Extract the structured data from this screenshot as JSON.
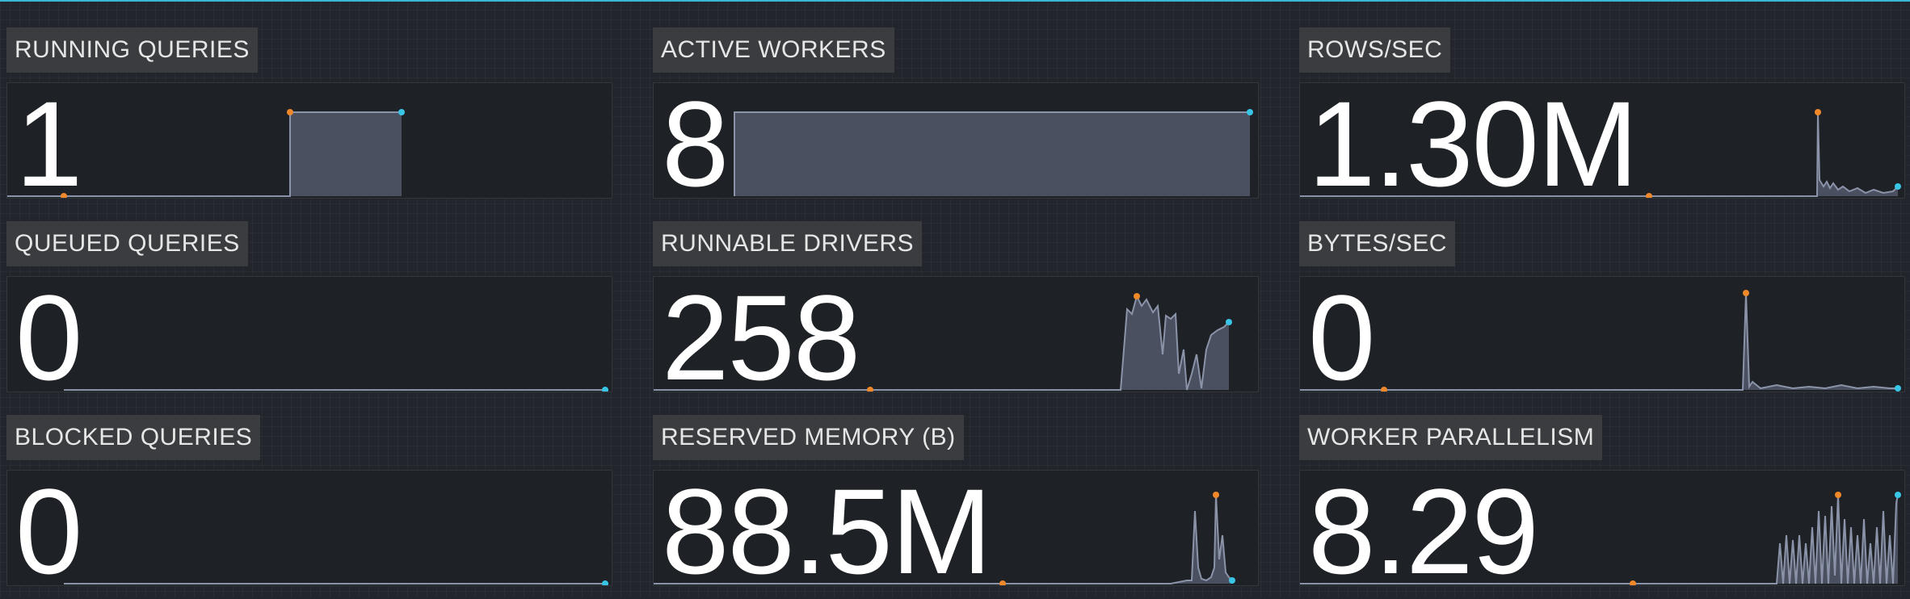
{
  "metrics": {
    "running_queries": {
      "label": "RUNNING QUERIES",
      "value": "1"
    },
    "active_workers": {
      "label": "ACTIVE WORKERS",
      "value": "8"
    },
    "rows_sec": {
      "label": "ROWS/SEC",
      "value": "1.30M"
    },
    "queued_queries": {
      "label": "QUEUED QUERIES",
      "value": "0"
    },
    "runnable_drivers": {
      "label": "RUNNABLE DRIVERS",
      "value": "258"
    },
    "bytes_sec": {
      "label": "BYTES/SEC",
      "value": "0"
    },
    "blocked_queries": {
      "label": "BLOCKED QUERIES",
      "value": "0"
    },
    "reserved_memory": {
      "label": "RESERVED MEMORY (B)",
      "value": "88.5M"
    },
    "worker_parallelism": {
      "label": "WORKER PARALLELISM",
      "value": "8.29"
    }
  },
  "colors": {
    "accent_line": "#39b8d6",
    "spark_fill": "#4a5060",
    "spark_line": "#8a93a8",
    "min_dot": "#f0882a",
    "end_dot": "#39c6e6"
  }
}
